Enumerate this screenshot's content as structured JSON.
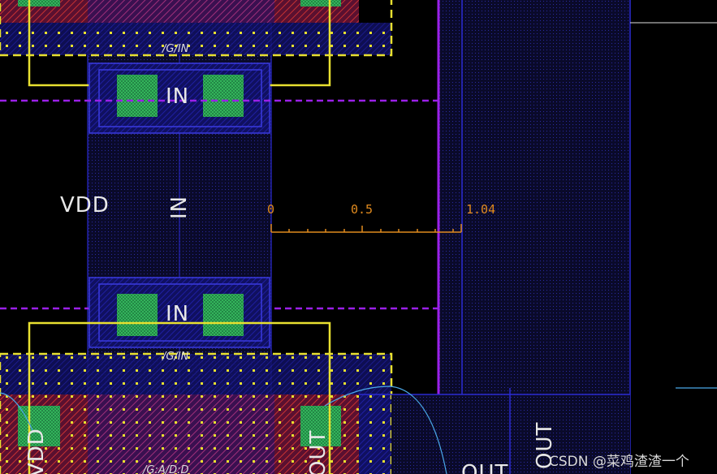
{
  "labels": {
    "vdd_left": "VDD",
    "in_upper": "IN",
    "in_middle": "IN",
    "in_lower": "IN",
    "gin_upper": "/G/IN",
    "gin_lower": "/G/IN",
    "vdd_bottom": "VDD",
    "out_bottom": "OUT",
    "out_right": "OUT",
    "out_bottom_right": "OUT",
    "gvdd_bottom": "/G:A/D:D"
  },
  "ruler": {
    "tick_0": "0",
    "tick_05": "0.5",
    "tick_end": "1.04"
  },
  "watermark": "CSDN @菜鸡渣渣一个",
  "colors": {
    "poly": "#1a1adc",
    "diffusion_red": "#c83232",
    "metal_blue": "#2020c8",
    "contact_green": "#2fbf4f",
    "select_yellow": "#e8e030",
    "nwell_purple": "#9a20e8",
    "ruler_orange": "#e08a1e"
  }
}
